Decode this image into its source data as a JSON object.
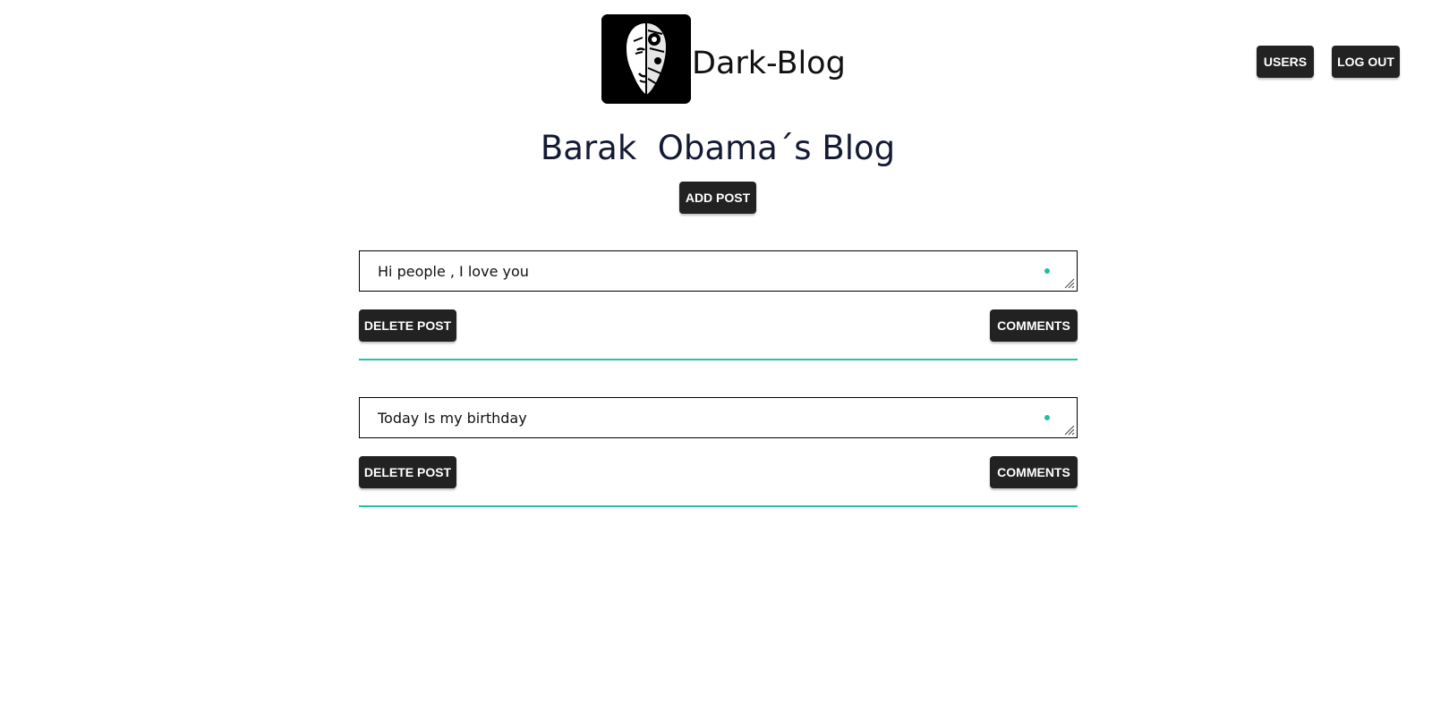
{
  "header": {
    "brand": "Dark-Blog",
    "logo_icon": "dark-face-logo",
    "nav": {
      "users_label": "USERS",
      "logout_label": "LOG OUT"
    }
  },
  "page": {
    "title": "Barak  Obama´s Blog",
    "add_post_label": "ADD POST"
  },
  "posts": [
    {
      "text": "Hi people , I love you",
      "delete_label": "DELETE POST",
      "comments_label": "COMMENTS"
    },
    {
      "text": "Today Is my birthday",
      "delete_label": "DELETE POST",
      "comments_label": "COMMENTS"
    }
  ],
  "colors": {
    "accent": "#27c2a6",
    "button_bg": "#222222",
    "title": "#151a33"
  }
}
